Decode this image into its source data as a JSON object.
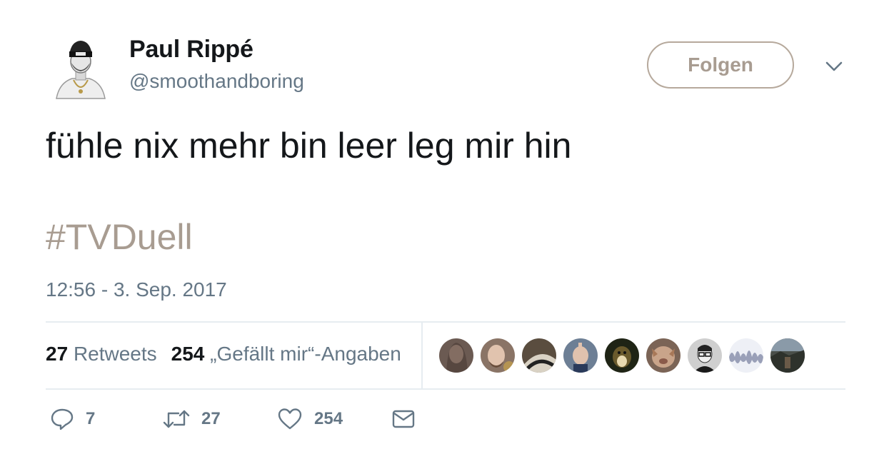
{
  "author": {
    "name": "Paul Rippé",
    "handle": "@smoothandboring",
    "follow_label": "Folgen"
  },
  "tweet": {
    "text": "fühle nix mehr bin leer leg mir hin",
    "hashtag": "#TVDuell",
    "timestamp": "12:56 - 3. Sep. 2017"
  },
  "stats": {
    "retweets_count": "27",
    "retweets_label": "Retweets",
    "likes_count": "254",
    "likes_label": "„Gefällt mir“-Angaben"
  },
  "likers": [
    {
      "color": "#6b5a52"
    },
    {
      "color": "#8a7466"
    },
    {
      "color": "#5a4d3f"
    },
    {
      "color": "#6d7f95"
    },
    {
      "color": "#6a5a2c"
    },
    {
      "color": "#7b6456"
    },
    {
      "color": "#cfcfcf"
    },
    {
      "color": "#9aa0b8"
    },
    {
      "color": "#4a4f4a"
    }
  ],
  "actions": {
    "reply_count": "7",
    "retweet_count": "27",
    "like_count": "254"
  },
  "colors": {
    "accent": "#a89c91",
    "muted": "#657786",
    "text": "#14171a",
    "divider": "#e6ecf0"
  },
  "icons": [
    "reply-icon",
    "retweet-icon",
    "heart-icon",
    "mail-icon",
    "chevron-down-icon"
  ]
}
